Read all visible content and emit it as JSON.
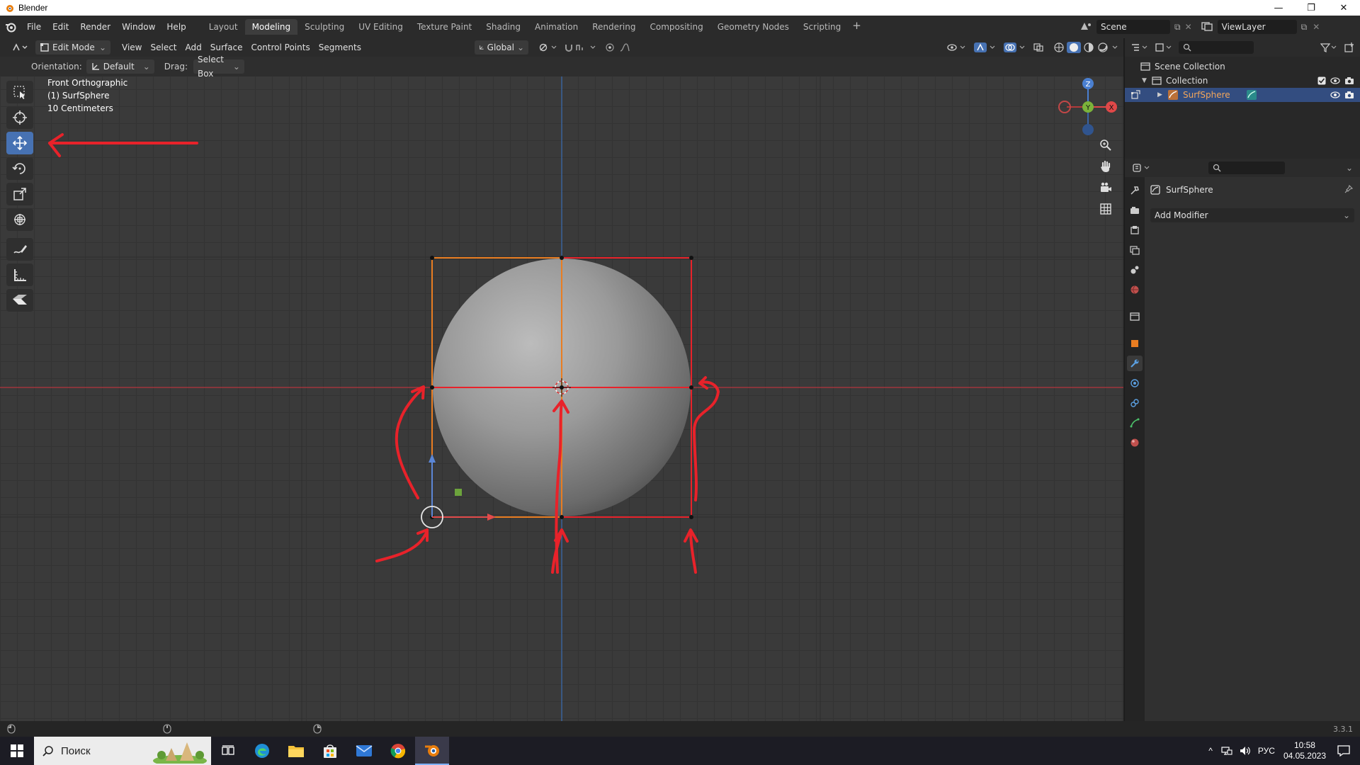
{
  "window": {
    "title": "Blender",
    "minimize": "—",
    "maximize": "❐",
    "close": "✕"
  },
  "menu": {
    "items": [
      "File",
      "Edit",
      "Render",
      "Window",
      "Help"
    ],
    "workspaces": [
      "Layout",
      "Modeling",
      "Sculpting",
      "UV Editing",
      "Texture Paint",
      "Shading",
      "Animation",
      "Rendering",
      "Compositing",
      "Geometry Nodes",
      "Scripting"
    ],
    "active_workspace": "Modeling",
    "add_tab": "+",
    "scene": "Scene",
    "view_layer": "ViewLayer"
  },
  "viewport_header": {
    "mode": "Edit Mode",
    "menus": [
      "View",
      "Select",
      "Add",
      "Surface",
      "Control Points",
      "Segments"
    ],
    "transform_orientation": "Global"
  },
  "tool_settings": {
    "orientation_label": "Orientation:",
    "orientation_value": "Default",
    "drag_label": "Drag:",
    "drag_value": "Select Box"
  },
  "overlay": {
    "view_name": "Front Orthographic",
    "object": "(1) SurfSphere",
    "scale": "10 Centimeters"
  },
  "gizmo": {
    "z": "Z",
    "y": "Y",
    "x": "X"
  },
  "outliner": {
    "scene_collection": "Scene Collection",
    "collection": "Collection",
    "object": "SurfSphere"
  },
  "properties": {
    "object_name": "SurfSphere",
    "add_modifier": "Add Modifier"
  },
  "status": {
    "version": "3.3.1"
  },
  "taskbar": {
    "search_placeholder": "Поиск",
    "language": "РУС",
    "time": "10:58",
    "date": "04.05.2023"
  },
  "colors": {
    "accent": "#4772b3",
    "selection_orange": "#e97d21",
    "annotation_red": "#e8222a",
    "axis_red": "#b3353e",
    "axis_blue": "#3d6fb5"
  }
}
